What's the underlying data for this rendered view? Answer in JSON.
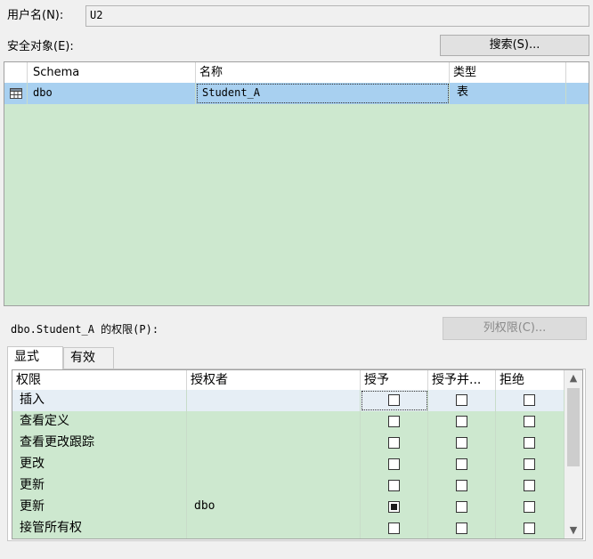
{
  "user": {
    "label": "用户名(N):",
    "value": "U2"
  },
  "securables": {
    "label": "安全对象(E):",
    "search_button": "搜索(S)...",
    "columns": [
      "Schema",
      "名称",
      "类型"
    ],
    "rows": [
      {
        "schema": "dbo",
        "name": "Student_A",
        "type": "表",
        "icon": "table-icon",
        "selected": true
      }
    ]
  },
  "permissions": {
    "label": "dbo.Student_A 的权限(P):",
    "column_permissions_button": "列权限(C)...",
    "tabs": [
      "显式",
      "有效"
    ],
    "active_tab": 0,
    "columns": [
      "权限",
      "授权者",
      "授予",
      "授予并...",
      "拒绝"
    ],
    "rows": [
      {
        "permission": "插入",
        "grantor": "",
        "grant": false,
        "with_grant": false,
        "deny": false
      },
      {
        "permission": "查看定义",
        "grantor": "",
        "grant": false,
        "with_grant": false,
        "deny": false
      },
      {
        "permission": "查看更改跟踪",
        "grantor": "",
        "grant": false,
        "with_grant": false,
        "deny": false
      },
      {
        "permission": "更改",
        "grantor": "",
        "grant": false,
        "with_grant": false,
        "deny": false
      },
      {
        "permission": "更新",
        "grantor": "",
        "grant": false,
        "with_grant": false,
        "deny": false
      },
      {
        "permission": "更新",
        "grantor": "dbo",
        "grant": true,
        "with_grant": false,
        "deny": false
      },
      {
        "permission": "接管所有权",
        "grantor": "",
        "grant": false,
        "with_grant": false,
        "deny": false
      }
    ]
  },
  "colors": {
    "grid_bg": "#cde8cf",
    "selection": "#a8d0f0"
  }
}
